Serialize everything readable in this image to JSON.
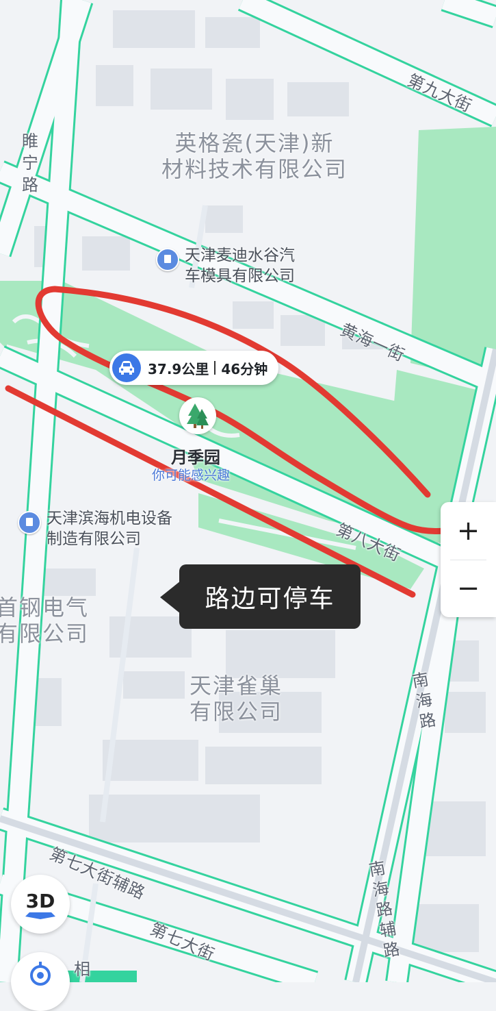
{
  "colors": {
    "background": "#f1f3f6",
    "road_fill": "#f8fafc",
    "road_border": "#34d39e",
    "green_area": "#a8e8c0",
    "building": "#dfe3e9",
    "annotation_red": "#e23a32",
    "route_blue": "#3c78e6",
    "tooltip_bg": "#2b2b2b"
  },
  "area_labels": {
    "ingcao": "英格瓷(天津)新\n材料技术有限公司",
    "shougang": "首钢电气\n有限公司",
    "quechao": "天津雀巢\n有限公司"
  },
  "poi": {
    "maidi": {
      "icon": "building-pin-icon",
      "text": "天津麦迪水谷汽\n车模具有限公司"
    },
    "binhai": {
      "icon": "building-pin-icon",
      "text": "天津滨海机电设备\n制造有限公司"
    }
  },
  "roads": {
    "suining": "睢宁路",
    "di_jiu": "第九大街",
    "huanghai": "黄海一街",
    "di_ba": "第八大街",
    "nanhai": "南海路",
    "di_qi_fu": "第七大街辅路",
    "di_qi": "第七大街",
    "nanhai_fu": "南海路辅路",
    "xiang": "相"
  },
  "route": {
    "icon": "car-icon",
    "distance": "37.9公里",
    "duration": "46分钟"
  },
  "park": {
    "icon": "tree-icon",
    "name": "月季园",
    "subtitle": "你可能感兴趣"
  },
  "tooltip": {
    "text": "路边可停车"
  },
  "zoom": {
    "plus": "+",
    "minus": "−"
  },
  "controls": {
    "view_3d": "3D",
    "locate_icon": "locate-icon"
  }
}
